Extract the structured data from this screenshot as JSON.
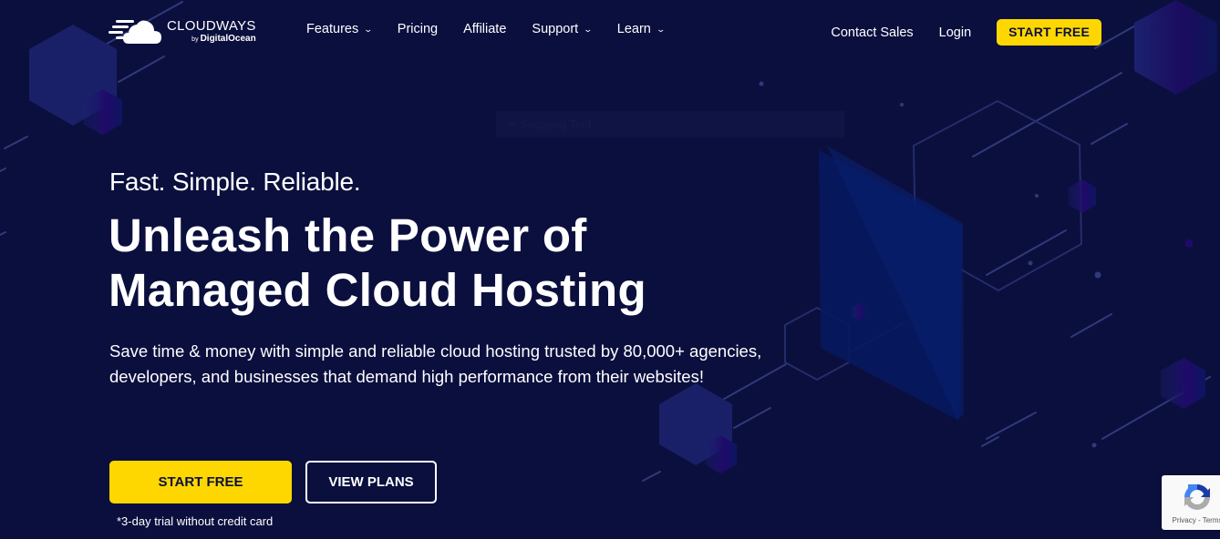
{
  "colors": {
    "background": "#0b0f3e",
    "accent_yellow": "#ffd700",
    "text": "#ffffff"
  },
  "header": {
    "logo": {
      "name": "CLOUDWAYS",
      "by_prefix": "by",
      "by_brand": "DigitalOcean",
      "icon": "cloud-logo-icon"
    },
    "nav": [
      {
        "label": "Features",
        "has_dropdown": true
      },
      {
        "label": "Pricing",
        "has_dropdown": false
      },
      {
        "label": "Affiliate",
        "has_dropdown": false
      },
      {
        "label": "Support",
        "has_dropdown": true
      },
      {
        "label": "Learn",
        "has_dropdown": true
      }
    ],
    "dropdown_glyph": "⌄",
    "contact_sales": "Contact Sales",
    "login": "Login",
    "start_free": "START FREE"
  },
  "overlay": {
    "snipping_tool_label": "✂ Snipping Tool"
  },
  "hero": {
    "tagline": "Fast. Simple. Reliable.",
    "headline_line1": "Unleash the Power of",
    "headline_line2": "Managed Cloud Hosting",
    "subtext": "Save time & money with simple and reliable cloud hosting trusted by 80,000+ agencies, developers, and businesses that demand high performance from their websites!",
    "start_free_button": "START FREE",
    "view_plans_button": "VIEW PLANS",
    "trial_note": "*3-day trial without credit card"
  },
  "recaptcha": {
    "links": "Privacy - Terms",
    "icon": "recaptcha-icon"
  }
}
